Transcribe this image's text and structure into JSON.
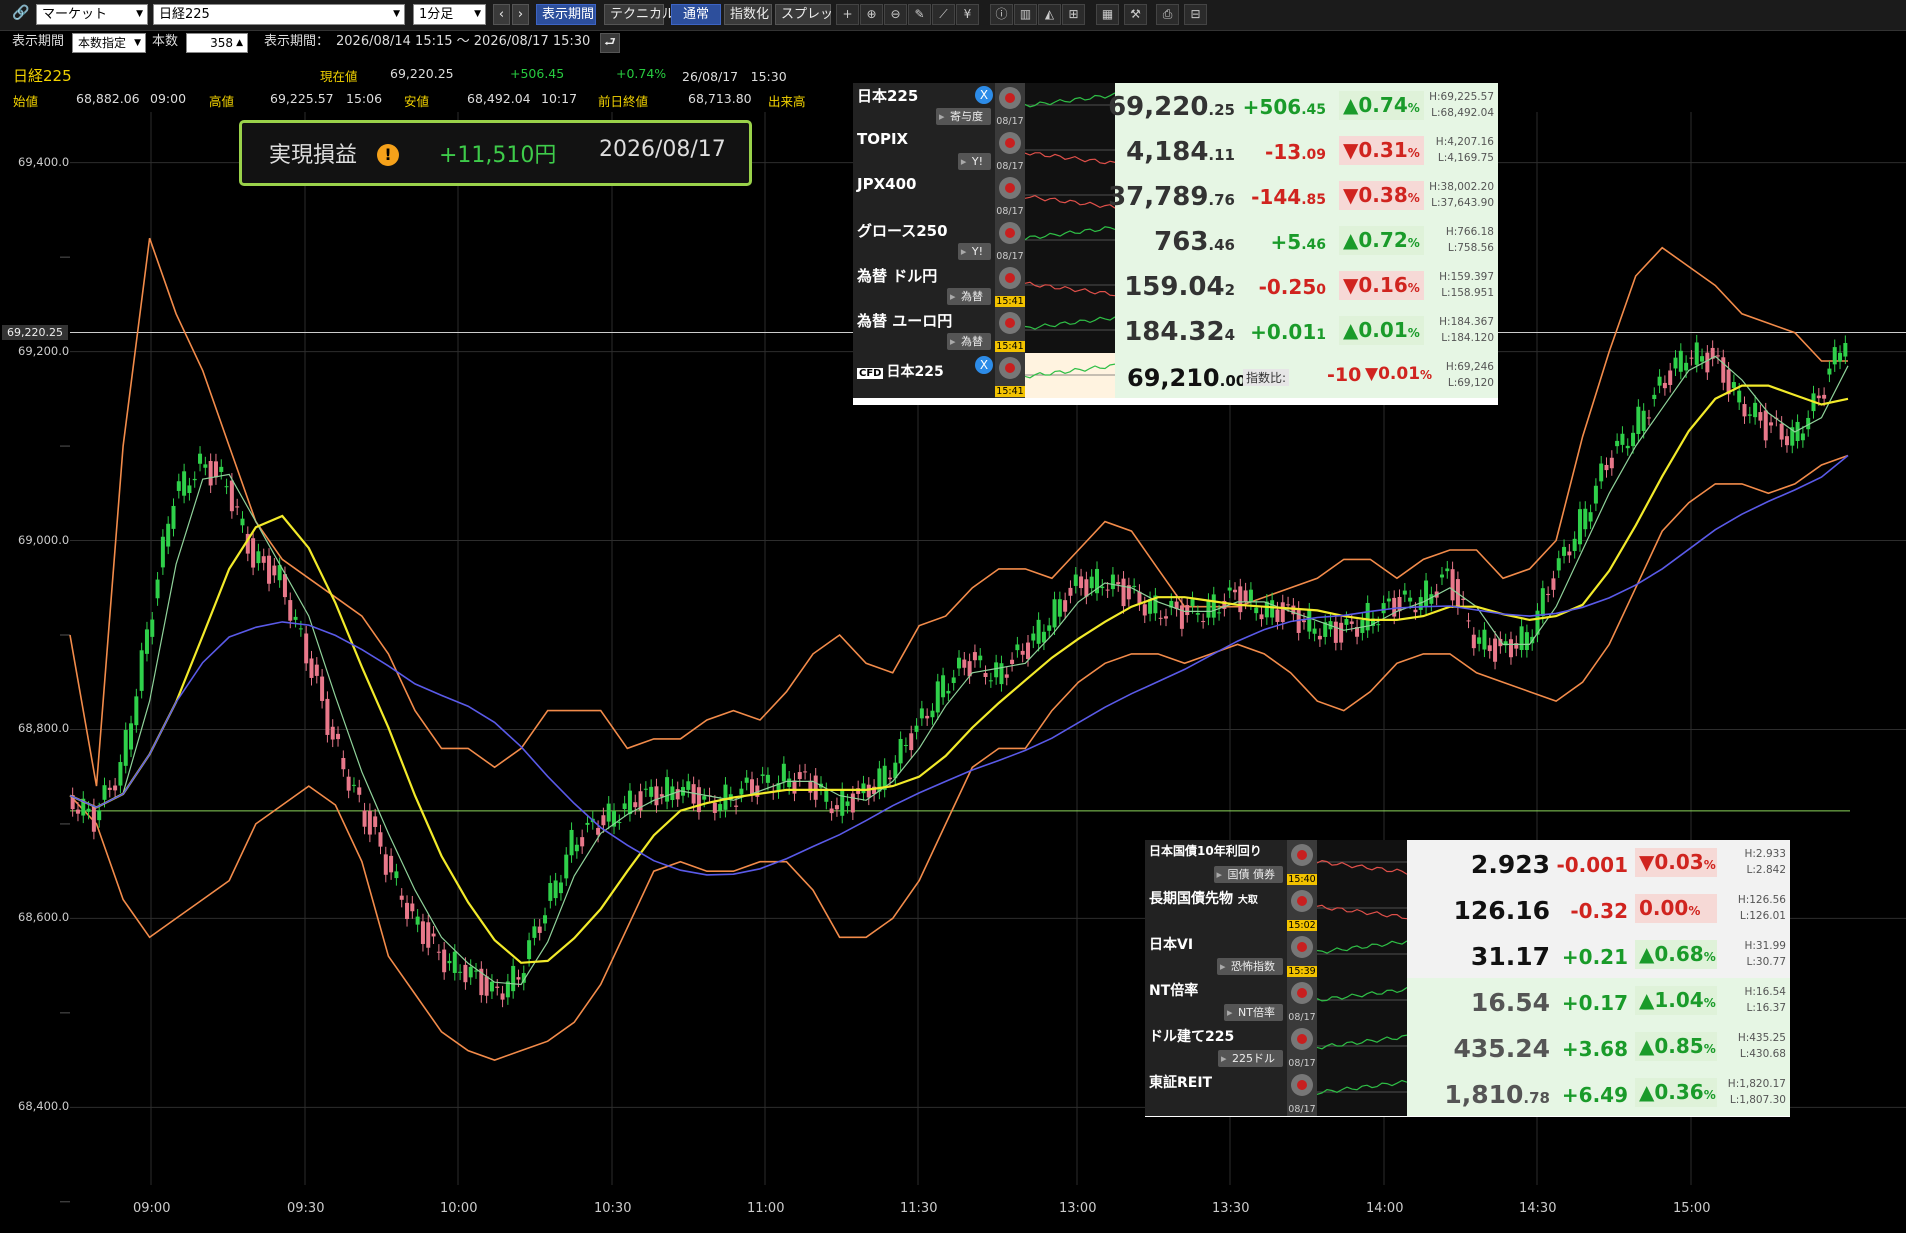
{
  "toolbar": {
    "category_select": "マーケット",
    "symbol_select": "日経225",
    "interval_select": "1分足",
    "prev_label": "‹",
    "next_label": "›",
    "period_button": "表示期間",
    "technical_button": "テクニカル",
    "normal_button": "通常",
    "index_button": "指数化",
    "spread_button": "スプレッド"
  },
  "period_row": {
    "label": "表示期間",
    "mode_select": "本数指定",
    "count_label": "本数",
    "count_value": "358",
    "range_label": "表示期間：",
    "range_value": "2026/08/14 15:15 ～ 2026/08/17 15:30"
  },
  "quote": {
    "name": "日経225",
    "current_label": "現在値",
    "current_value": "69,220.25",
    "change": "+506.45",
    "change_pct": "+0.74%",
    "datetime": "26/08/17　15:30",
    "open_label": "始値",
    "open_value": "68,882.06",
    "open_time": "09:00",
    "high_label": "高値",
    "high_value": "69,225.57",
    "high_time": "15:06",
    "low_label": "安値",
    "low_value": "68,492.04",
    "low_time": "10:17",
    "prev_close_label": "前日終値",
    "prev_close_value": "68,713.80",
    "volume_label": "出来高"
  },
  "realized_pl": {
    "label": "実現損益",
    "warn": "!",
    "value": "+11,510円",
    "date": "2026/08/17"
  },
  "current_price_tag": "69,220.25",
  "colors": {
    "up": "#1a9b2a",
    "down": "#d0241f",
    "band": "#f28b4a",
    "ma_short": "#f2ea2a",
    "ma_long": "#5a5ae8",
    "ma_fast": "#8fd29a",
    "candle_up": "#2fd04a",
    "candle_down": "#e8788a"
  },
  "chart_data": {
    "type": "line",
    "title": "",
    "y_ticks": [
      "69,400.0",
      "69,200.0",
      "69,000.0",
      "68,800.0",
      "68,600.0",
      "68,400.0"
    ],
    "ylim": [
      68376,
      69424
    ],
    "x_ticks": [
      "09:00",
      "09:30",
      "10:00",
      "10:30",
      "11:00",
      "11:30",
      "13:00",
      "13:30",
      "14:00",
      "14:30",
      "15:00"
    ],
    "x": [
      "08:47",
      "09:00",
      "09:05",
      "09:10",
      "09:15",
      "09:20",
      "09:25",
      "09:30",
      "09:35",
      "09:40",
      "09:45",
      "09:50",
      "09:55",
      "10:00",
      "10:05",
      "10:10",
      "10:15",
      "10:20",
      "10:25",
      "10:30",
      "10:35",
      "10:40",
      "10:45",
      "10:50",
      "10:55",
      "11:00",
      "11:05",
      "11:10",
      "11:15",
      "11:20",
      "11:25",
      "11:30",
      "12:35",
      "12:40",
      "12:45",
      "12:50",
      "12:55",
      "13:00",
      "13:05",
      "13:10",
      "13:15",
      "13:20",
      "13:25",
      "13:30",
      "13:35",
      "13:40",
      "13:45",
      "13:50",
      "13:55",
      "14:00",
      "14:05",
      "14:10",
      "14:15",
      "14:20",
      "14:25",
      "14:30",
      "14:35",
      "14:40",
      "14:45",
      "14:50",
      "14:55",
      "15:00",
      "15:05",
      "15:10",
      "15:15",
      "15:20",
      "15:25",
      "15:30"
    ],
    "series": [
      {
        "values": [
          68730,
          68705,
          68760,
          68900,
          69050,
          69080,
          69060,
          68980,
          68960,
          68880,
          68790,
          68720,
          68660,
          68600,
          68560,
          68545,
          68520,
          68540,
          68610,
          68680,
          68700,
          68720,
          68730,
          68740,
          68720,
          68730,
          68740,
          68750,
          68740,
          68720,
          68730,
          68760,
          68800,
          68850,
          68870,
          68860,
          68880,
          68920,
          68950,
          68960,
          68940,
          68930,
          68920,
          68930,
          68940,
          68930,
          68920,
          68910,
          68900,
          68920,
          68930,
          68940,
          68960,
          68900,
          68880,
          68900,
          68960,
          69020,
          69080,
          69120,
          69160,
          69200,
          69190,
          69150,
          69120,
          69110,
          69150,
          69220
        ]
      }
    ],
    "bands": {
      "upper": [
        68900,
        68740,
        69100,
        69320,
        69240,
        69180,
        69100,
        69020,
        68980,
        68960,
        68940,
        68920,
        68880,
        68820,
        68780,
        68780,
        68760,
        68780,
        68820,
        68820,
        68820,
        68780,
        68790,
        68790,
        68810,
        68820,
        68810,
        68840,
        68880,
        68900,
        68870,
        68860,
        68910,
        68920,
        68950,
        68970,
        68970,
        68960,
        68990,
        69020,
        69010,
        68970,
        68930,
        68930,
        68930,
        68940,
        68950,
        68960,
        68980,
        68980,
        68960,
        68980,
        68990,
        68990,
        68960,
        68970,
        69000,
        69110,
        69200,
        69280,
        69310,
        69290,
        69270,
        69240,
        69230,
        69220,
        69190,
        69190
      ],
      "lower": [
        68730,
        68700,
        68620,
        68580,
        68600,
        68620,
        68640,
        68700,
        68720,
        68740,
        68720,
        68660,
        68560,
        68520,
        68480,
        68460,
        68450,
        68460,
        68470,
        68490,
        68530,
        68590,
        68650,
        68660,
        68650,
        68650,
        68660,
        68660,
        68630,
        68580,
        68580,
        68600,
        68640,
        68700,
        68760,
        68780,
        68780,
        68820,
        68850,
        68870,
        68880,
        68880,
        68870,
        68880,
        68890,
        68880,
        68860,
        68830,
        68820,
        68840,
        68870,
        68880,
        68880,
        68860,
        68850,
        68840,
        68830,
        68850,
        68890,
        68950,
        69010,
        69040,
        69060,
        69060,
        69050,
        69060,
        69080,
        69090
      ]
    }
  },
  "market_panel": {
    "rows": [
      {
        "name": "日本225",
        "sub": "寄与度",
        "x": true,
        "date": "08/17",
        "live": false,
        "value": "69,220",
        "dec": ".25",
        "chg": "+506",
        "chgd": ".45",
        "dir": "up",
        "pct": "0.74",
        "H": "H:69,225.57",
        "L": "L:68,492.04"
      },
      {
        "name": "TOPIX",
        "sub": "Y!",
        "x": false,
        "date": "08/17",
        "live": false,
        "value": "4,184",
        "dec": ".11",
        "chg": "-13",
        "chgd": ".09",
        "dir": "dn",
        "pct": "0.31",
        "H": "H:4,207.16",
        "L": "L:4,169.75"
      },
      {
        "name": "JPX400",
        "sub": "",
        "x": false,
        "date": "08/17",
        "live": false,
        "value": "37,789",
        "dec": ".76",
        "chg": "-144",
        "chgd": ".85",
        "dir": "dn",
        "pct": "0.38",
        "H": "H:38,002.20",
        "L": "L:37,643.90"
      },
      {
        "name": "グロース250",
        "sub": "Y!",
        "x": false,
        "date": "08/17",
        "live": false,
        "value": "763",
        "dec": ".46",
        "chg": "+5",
        "chgd": ".46",
        "dir": "up",
        "pct": "0.72",
        "H": "H:766.18",
        "L": "L:758.56"
      },
      {
        "name": "為替 ドル円",
        "sub": "為替",
        "x": false,
        "date": "15:41",
        "live": true,
        "value": "159.04",
        "dec": "2",
        "chg": "-0.25",
        "chgd": "0",
        "dir": "dn",
        "pct": "0.16",
        "H": "H:159.397",
        "L": "L:158.951"
      },
      {
        "name": "為替 ユーロ円",
        "sub": "為替",
        "x": false,
        "date": "15:41",
        "live": true,
        "value": "184.32",
        "dec": "4",
        "chg": "+0.01",
        "chgd": "1",
        "dir": "up",
        "pct": "0.01",
        "H": "H:184.367",
        "L": "L:184.120"
      }
    ],
    "cfd": {
      "badge": "CFD",
      "name": "日本225",
      "date": "15:41",
      "value": "69,210",
      "dec": ".00",
      "ratio_label": "指数比:",
      "ratio": "-10",
      "pct": "0.01",
      "H": "H:69,246",
      "L": "L:69,120"
    }
  },
  "bond_panel": {
    "rows": [
      {
        "name": "日本国債10年利回り",
        "sub": "国債 債券",
        "date": "15:40",
        "live": true,
        "value": "2.923",
        "chg": "-0.001",
        "dir": "dn",
        "pct": "▼0.03",
        "H": "H:2.933",
        "L": "L:2.842"
      },
      {
        "name": "長期国債先物",
        "name2": "大取",
        "sub": "",
        "date": "15:02",
        "live": true,
        "value": "126.16",
        "chg": "-0.32",
        "dir": "dn",
        "pct": "0.00",
        "H": "H:126.56",
        "L": "L:126.01"
      },
      {
        "name": "日本VI",
        "sub": "恐怖指数",
        "date": "15:39",
        "live": true,
        "value": "31.17",
        "chg": "+0.21",
        "dir": "up",
        "pct": "▲0.68",
        "H": "H:31.99",
        "L": "L:30.77"
      },
      {
        "name": "NT倍率",
        "sub": "NT倍率",
        "date": "08/17",
        "live": false,
        "value": "16.54",
        "chg": "+0.17",
        "dir": "up",
        "pct": "▲1.04",
        "H": "H:16.54",
        "L": "L:16.37"
      },
      {
        "name": "ドル建て225",
        "sub": "225ドル",
        "date": "08/17",
        "live": false,
        "value": "435.24",
        "chg": "+3.68",
        "dir": "up",
        "pct": "▲0.85",
        "H": "H:435.25",
        "L": "L:430.68"
      },
      {
        "name": "東証REIT",
        "sub": "",
        "date": "08/17",
        "live": false,
        "value": "1,810",
        "dec": ".78",
        "chg": "+6.49",
        "dir": "up",
        "pct": "▲0.36",
        "H": "H:1,820.17",
        "L": "L:1,807.30"
      }
    ]
  }
}
